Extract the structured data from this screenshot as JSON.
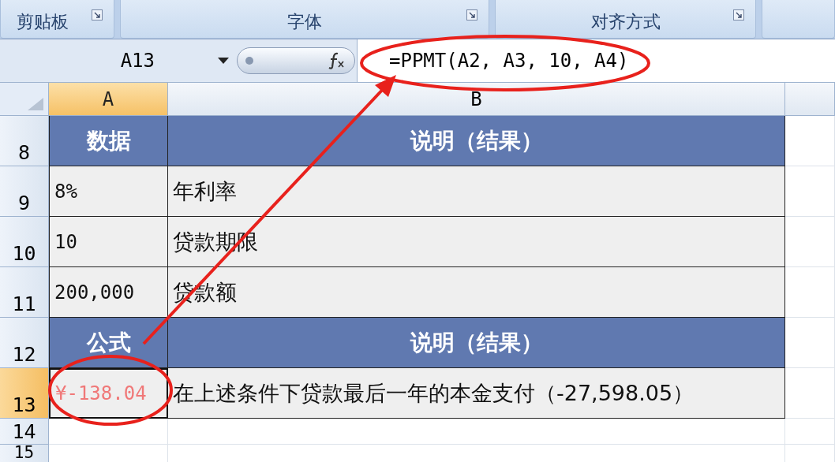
{
  "ribbon_groups": [
    {
      "label": "剪贴板"
    },
    {
      "label": "字体"
    },
    {
      "label": "对齐方式"
    }
  ],
  "formula_bar": {
    "name_box": "A13",
    "formula": "=PPMT(A2, A3, 10, A4)"
  },
  "columns": [
    {
      "label": "A",
      "selected": true
    },
    {
      "label": "B",
      "selected": false
    }
  ],
  "rows": [
    {
      "number": "8",
      "selected": false,
      "kind": "header",
      "cells": [
        {
          "text": "数据",
          "selected": false,
          "negative": false
        },
        {
          "text": "说明（结果）",
          "selected": false,
          "negative": false
        }
      ]
    },
    {
      "number": "9",
      "selected": false,
      "kind": "data",
      "cells": [
        {
          "text": "8%",
          "selected": false,
          "negative": false
        },
        {
          "text": "年利率",
          "selected": false,
          "negative": false
        }
      ]
    },
    {
      "number": "10",
      "selected": false,
      "kind": "data",
      "cells": [
        {
          "text": "10",
          "selected": false,
          "negative": false
        },
        {
          "text": "贷款期限",
          "selected": false,
          "negative": false
        }
      ]
    },
    {
      "number": "11",
      "selected": false,
      "kind": "data",
      "cells": [
        {
          "text": "200,000",
          "selected": false,
          "negative": false
        },
        {
          "text": "贷款额",
          "selected": false,
          "negative": false
        }
      ]
    },
    {
      "number": "12",
      "selected": false,
      "kind": "header",
      "cells": [
        {
          "text": "公式",
          "selected": false,
          "negative": false
        },
        {
          "text": "说明（结果）",
          "selected": false,
          "negative": false
        }
      ]
    },
    {
      "number": "13",
      "selected": true,
      "kind": "data",
      "cells": [
        {
          "text": "¥-138.04",
          "selected": true,
          "negative": true
        },
        {
          "text": "在上述条件下贷款最后一年的本金支付（-27,598.05）",
          "selected": false,
          "negative": false
        }
      ]
    },
    {
      "number": "14",
      "selected": false,
      "kind": "empty"
    },
    {
      "number": "15",
      "selected": false,
      "kind": "empty"
    }
  ]
}
